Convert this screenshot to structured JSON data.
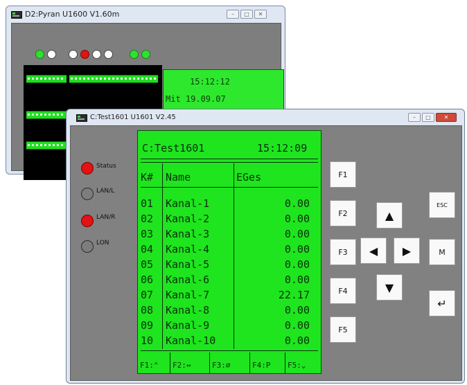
{
  "back_window": {
    "title": "D2:Pyran U1600  V1.60m",
    "controls": [
      "–",
      "□",
      "✕"
    ],
    "display_time": "15:12:12",
    "display_date": "Mit 19.09.07"
  },
  "front_window": {
    "title": "C:Test1601 U1601  V2.45",
    "controls": [
      "–",
      "□",
      "✕"
    ],
    "status_leds": [
      {
        "label": "Status",
        "state": "red"
      },
      {
        "label": "LAN/L",
        "state": "off"
      },
      {
        "label": "LAN/R",
        "state": "red"
      },
      {
        "label": "LON",
        "state": "off"
      }
    ],
    "lcd": {
      "title": "C:Test1601",
      "time": "15:12:09",
      "col_k": "K#",
      "col_name": "Name",
      "col_eges": "EGes",
      "rows": [
        {
          "k": "01",
          "name": "Kanal-1",
          "eges": "0.00"
        },
        {
          "k": "02",
          "name": "Kanal-2",
          "eges": "0.00"
        },
        {
          "k": "03",
          "name": "Kanal-3",
          "eges": "0.00"
        },
        {
          "k": "04",
          "name": "Kanal-4",
          "eges": "0.00"
        },
        {
          "k": "05",
          "name": "Kanal-5",
          "eges": "0.00"
        },
        {
          "k": "06",
          "name": "Kanal-6",
          "eges": "0.00"
        },
        {
          "k": "07",
          "name": "Kanal-7",
          "eges": "22.17"
        },
        {
          "k": "08",
          "name": "Kanal-8",
          "eges": "0.00"
        },
        {
          "k": "09",
          "name": "Kanal-9",
          "eges": "0.00"
        },
        {
          "k": "10",
          "name": "Kanal-10",
          "eges": "0.00"
        }
      ],
      "softkeys": [
        "F1:⌃",
        "F2:↔",
        "F3:⌀",
        "F4:P",
        "F5:⌄"
      ]
    },
    "keys": {
      "f1": "F1",
      "f2": "F2",
      "f3": "F3",
      "f4": "F4",
      "f5": "F5",
      "esc": "ESC",
      "m": "M",
      "up": "▲",
      "down": "▼",
      "left": "◀",
      "right": "▶",
      "enter": "↵"
    }
  },
  "colors": {
    "lcd": "#1ee51e",
    "led_red": "#e41212",
    "led_green": "#2fe02f",
    "client_gray": "#818181"
  }
}
